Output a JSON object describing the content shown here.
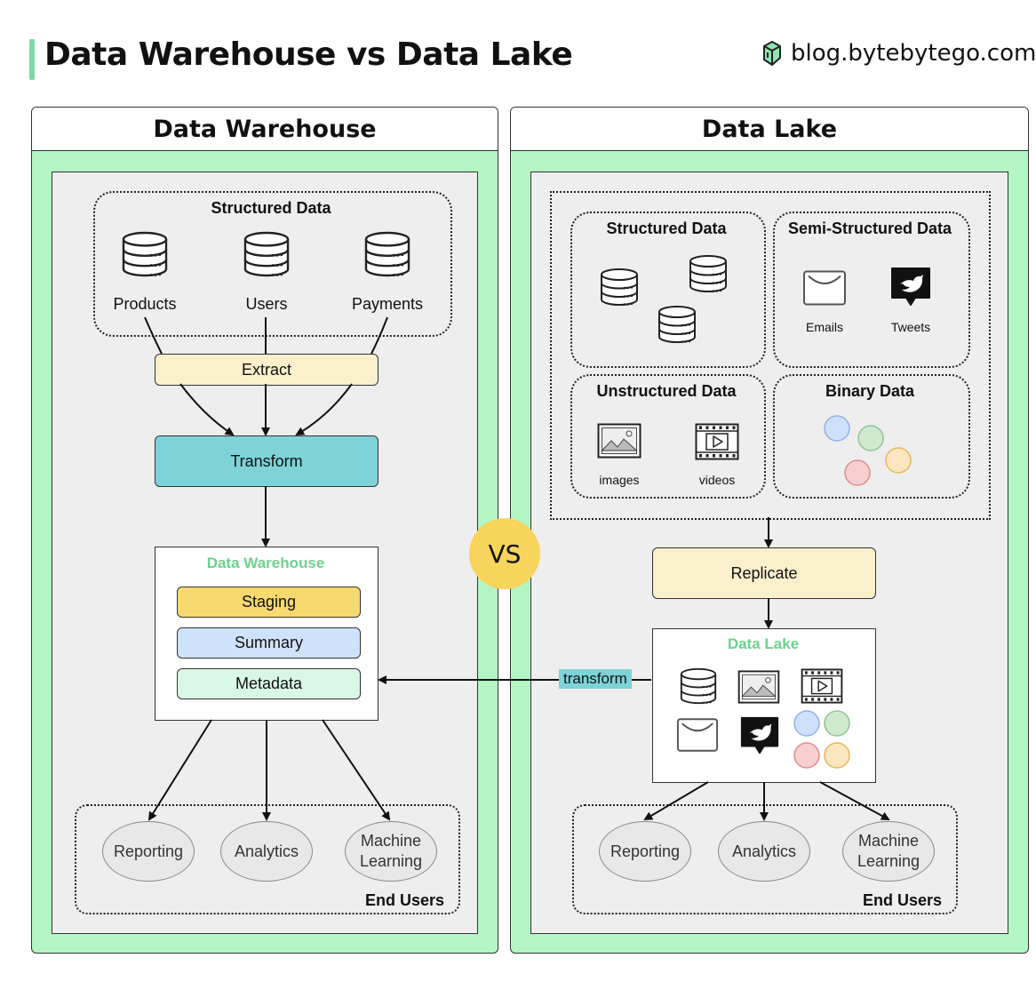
{
  "header": {
    "title": "Data Warehouse vs Data Lake",
    "brand": "blog.bytebytego.com"
  },
  "colors": {
    "panel_green": "#b4f5c4",
    "accent_bar": "#7fd9a8",
    "extract": "#fbf0cc",
    "transform": "#7dd3d8",
    "staging": "#f7d96f",
    "summary": "#cfe2fb",
    "metadata": "#d8f7e4",
    "vs": "#f7d45c",
    "green_label": "#6dd18e"
  },
  "vs_label": "VS",
  "warehouse": {
    "panel_title": "Data Warehouse",
    "source": {
      "title": "Structured Data",
      "items": [
        "Products",
        "Users",
        "Payments"
      ]
    },
    "extract": "Extract",
    "transform": "Transform",
    "store": {
      "title": "Data Warehouse",
      "layers": [
        "Staging",
        "Summary",
        "Metadata"
      ]
    },
    "end_users": {
      "title": "End Users",
      "items": [
        "Reporting",
        "Analytics",
        "Machine\nLearning"
      ]
    }
  },
  "lake": {
    "panel_title": "Data Lake",
    "sources": {
      "structured": "Structured Data",
      "semi_structured": {
        "title": "Semi-Structured Data",
        "items": [
          "Emails",
          "Tweets"
        ]
      },
      "unstructured": {
        "title": "Unstructured Data",
        "items": [
          "images",
          "videos"
        ]
      },
      "binary": "Binary Data"
    },
    "replicate": "Replicate",
    "store": {
      "title": "Data Lake"
    },
    "transform_tag": "transform",
    "end_users": {
      "title": "End Users",
      "items": [
        "Reporting",
        "Analytics",
        "Machine\nLearning"
      ]
    }
  },
  "icons": [
    "database-icon",
    "email-icon",
    "tweet-icon",
    "image-icon",
    "video-icon",
    "binary-bubble-icon",
    "bytebytego-logo-icon"
  ]
}
